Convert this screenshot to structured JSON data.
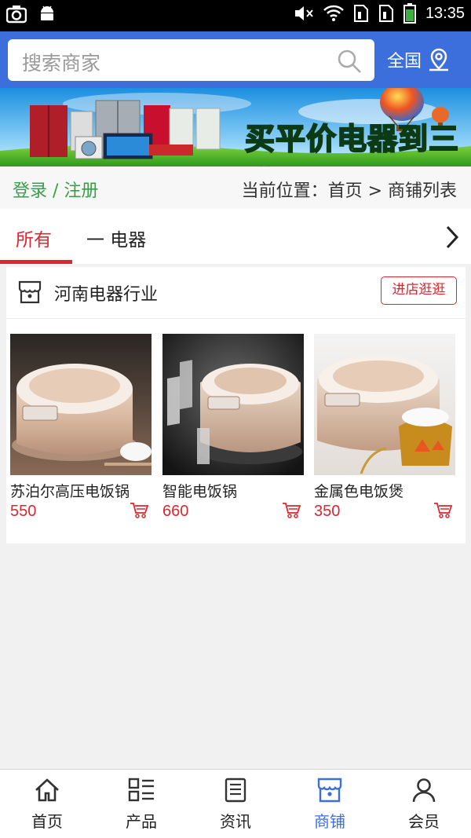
{
  "status_bar": {
    "time": "13:35"
  },
  "header": {
    "search_placeholder": "搜索商家",
    "region_label": "全国"
  },
  "banner": {
    "title": "买平价电器到三联"
  },
  "crumb": {
    "login_register": "登录 / 注册",
    "location": "当前位置：首页 > 商铺列表"
  },
  "tabs": [
    {
      "label": "所有"
    },
    {
      "label": "一 电器"
    }
  ],
  "shop": {
    "name": "河南电器行业",
    "visit_button": "进店逛逛",
    "products": [
      {
        "name": "苏泊尔高压电饭锅",
        "price": "550"
      },
      {
        "name": "智能电饭锅",
        "price": "660"
      },
      {
        "name": "金属色电饭煲",
        "price": "350"
      }
    ]
  },
  "bottom_nav": [
    {
      "label": "首页",
      "icon": "home-icon"
    },
    {
      "label": "产品",
      "icon": "grid-list-icon"
    },
    {
      "label": "资讯",
      "icon": "news-icon"
    },
    {
      "label": "商铺",
      "icon": "store-icon"
    },
    {
      "label": "会员",
      "icon": "user-icon"
    }
  ],
  "colors": {
    "accent_blue": "#3c6fdc",
    "accent_red": "#d9282f",
    "login_green": "#3b9d4a"
  }
}
